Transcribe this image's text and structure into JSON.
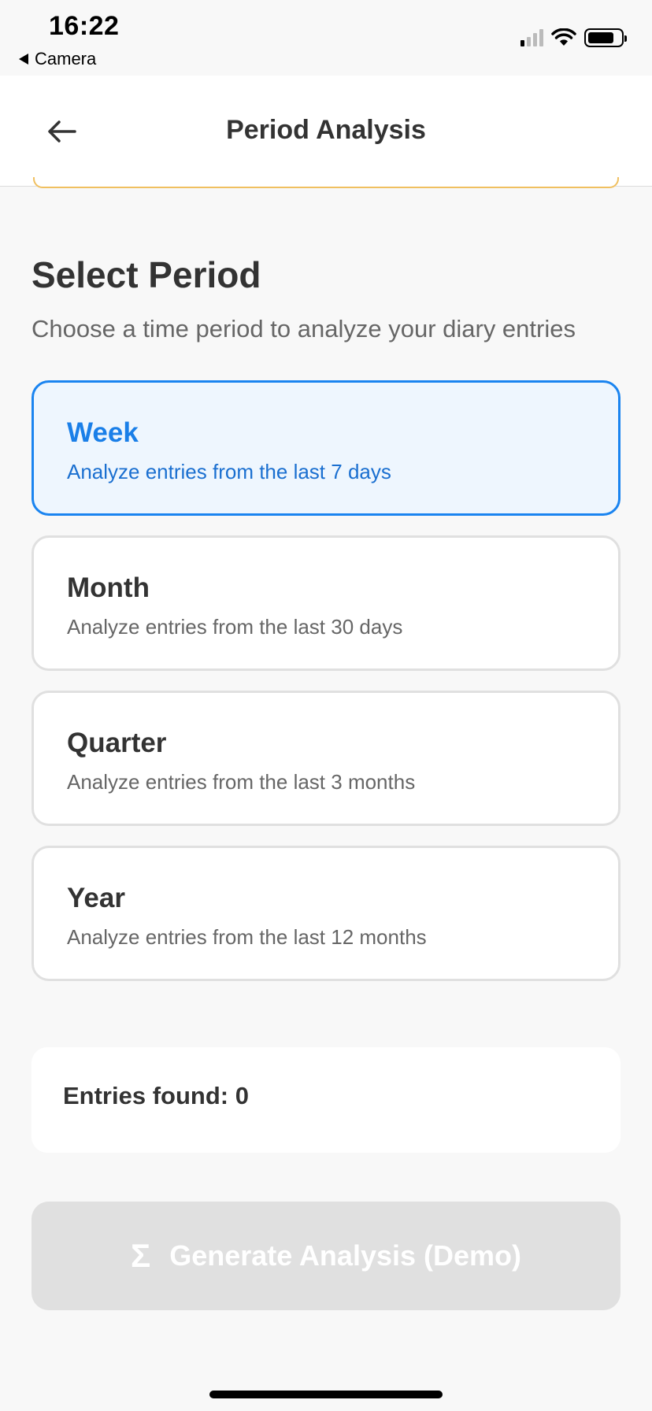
{
  "status_bar": {
    "time": "16:22",
    "back_app": "Camera"
  },
  "header": {
    "title": "Period Analysis",
    "back_icon": "arrow-left-icon"
  },
  "section": {
    "title": "Select Period",
    "subtitle": "Choose a time period to analyze your diary entries"
  },
  "periods": [
    {
      "title": "Week",
      "description": "Analyze entries from the last 7 days",
      "selected": true
    },
    {
      "title": "Month",
      "description": "Analyze entries from the last 30 days",
      "selected": false
    },
    {
      "title": "Quarter",
      "description": "Analyze entries from the last 3 months",
      "selected": false
    },
    {
      "title": "Year",
      "description": "Analyze entries from the last 12 months",
      "selected": false
    }
  ],
  "entries": {
    "label": "Entries found: 0"
  },
  "generate_button": {
    "icon": "Σ",
    "label": "Generate Analysis (Demo)",
    "disabled": true
  },
  "colors": {
    "accent": "#1a84f0",
    "selected_bg": "#eef6fe",
    "disabled_button": "#e0e0e0",
    "warning_border": "#f0c060"
  }
}
